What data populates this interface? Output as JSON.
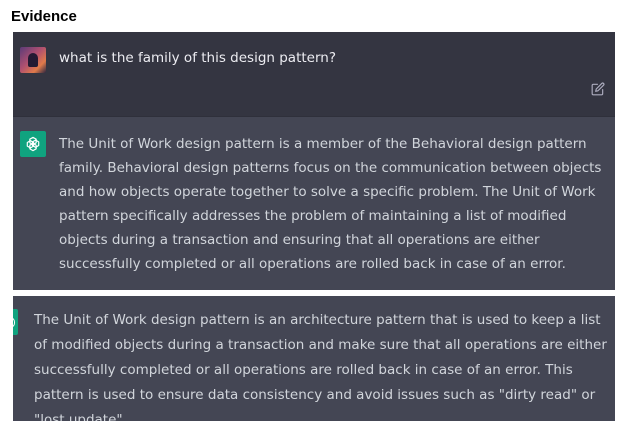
{
  "heading": "Evidence",
  "conversation": {
    "user_message": "what is the family of this design pattern?",
    "assistant_message": "The Unit of Work design pattern is a member of the Behavioral design pattern family. Behavioral design patterns focus on the communication between objects and how objects operate together to solve a specific problem. The Unit of Work pattern specifically addresses the problem of maintaining a list of modified objects during a transaction and ensuring that all operations are either successfully completed or all operations are rolled back in case of an error."
  },
  "second_response": {
    "text": "The Unit of Work design pattern is an architecture pattern that is used to keep a list of modified objects during a transaction and make sure that all operations are either successfully completed or all operations are rolled back in case of an error. This pattern is used to ensure data consistency and avoid issues such as \"dirty read\" or \"lost update\"."
  },
  "icons": {
    "user_avatar": "user-avatar",
    "edit": "edit-icon",
    "assistant": "openai-logo-icon"
  },
  "colors": {
    "user_row_bg": "#343541",
    "assistant_row_bg": "#444654",
    "text": "#d1d5db",
    "brand": "#10a37f"
  }
}
